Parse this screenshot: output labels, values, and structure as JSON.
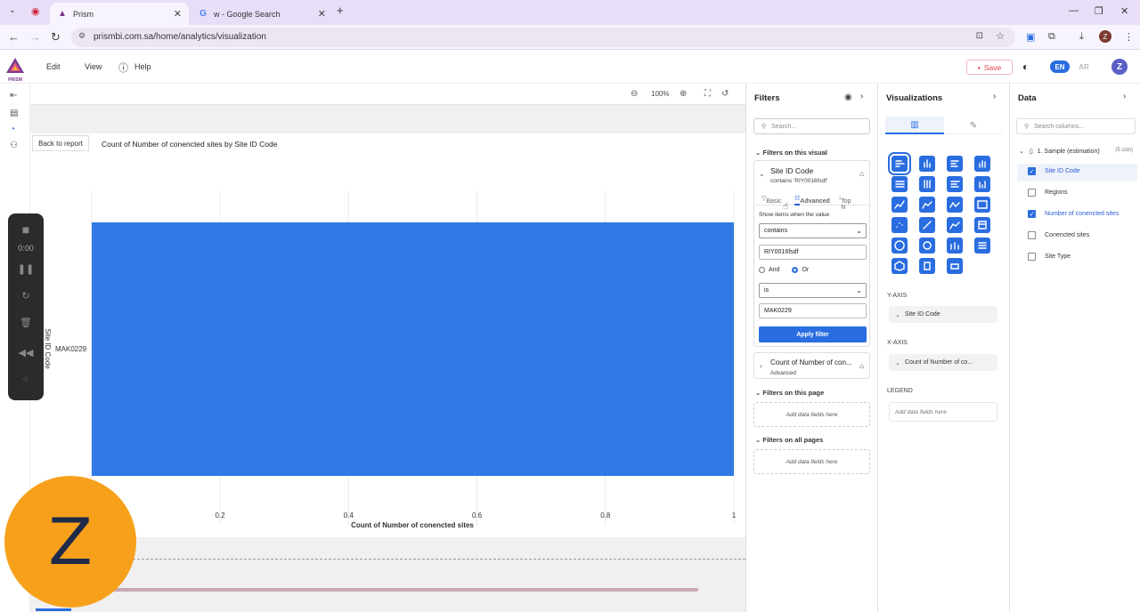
{
  "browser": {
    "tabs": [
      {
        "title": "Prism"
      },
      {
        "title": "w - Google Search"
      }
    ],
    "url": "prismbi.com.sa/home/analytics/visualization",
    "profile_initial": "Z"
  },
  "app": {
    "logo_text": "PRISM",
    "menu": {
      "edit": "Edit",
      "view": "View",
      "help": "Help"
    },
    "save_label": "Save",
    "lang_en": "EN",
    "lang_ar": "AR",
    "avatar_initial": "Z"
  },
  "canvas": {
    "zoom": "100%",
    "back_label": "Back to report",
    "visual_title": "Count of Number of conencted sites by Site ID Code"
  },
  "chart_data": {
    "type": "bar",
    "orientation": "horizontal",
    "categories": [
      "MAK0229"
    ],
    "values": [
      1
    ],
    "xlim": [
      0,
      1
    ],
    "x_ticks": [
      "0.2",
      "0.4",
      "0.6",
      "0.8",
      "1"
    ],
    "xlabel": "Count of Number of conencted sites",
    "ylabel": "Site ID Code",
    "bar_color": "#2f7ae5",
    "grid": true
  },
  "recorder": {
    "time": "0:00"
  },
  "big_avatar_initial": "Z",
  "filters": {
    "title": "Filters",
    "search_placeholder": "Search...",
    "on_visual_label": "Filters on this visual",
    "card1": {
      "field": "Site ID Code",
      "summary": "contains 'RIY0016fsdf'",
      "tabs": {
        "basic": "Basic",
        "advanced": "Advanced",
        "topn": "Top N"
      },
      "show_items_label": "Show items when the value",
      "op1": "contains",
      "value1": "RIY0016fsdf",
      "and_label": "And",
      "or_label": "Or",
      "op2": "is",
      "value2": "MAK0229",
      "apply_label": "Apply filter"
    },
    "card2": {
      "field": "Count of Number of con...",
      "summary": "Advanced"
    },
    "on_page_label": "Filters on this page",
    "on_all_pages_label": "Filters on all pages",
    "add_fields_label": "Add data fields here"
  },
  "visualizations": {
    "title": "Visualizations",
    "yaxis_label": "Y-AXIS",
    "yaxis_field": "Site ID Code",
    "xaxis_label": "X-AXIS",
    "xaxis_field": "Count of Number of co...",
    "legend_label": "LEGEND",
    "legend_placeholder": "Add data fields here"
  },
  "data": {
    "title": "Data",
    "search_placeholder": "Search columns...",
    "table_name": "1. Sample (estimation)",
    "table_count": "(5 cols)",
    "fields": [
      {
        "label": "Site ID Code",
        "checked": true
      },
      {
        "label": "Regions",
        "checked": false
      },
      {
        "label": "Number of conencted sites",
        "checked": true
      },
      {
        "label": "Conencted sites",
        "checked": false
      },
      {
        "label": "Site Type",
        "checked": false
      }
    ]
  }
}
